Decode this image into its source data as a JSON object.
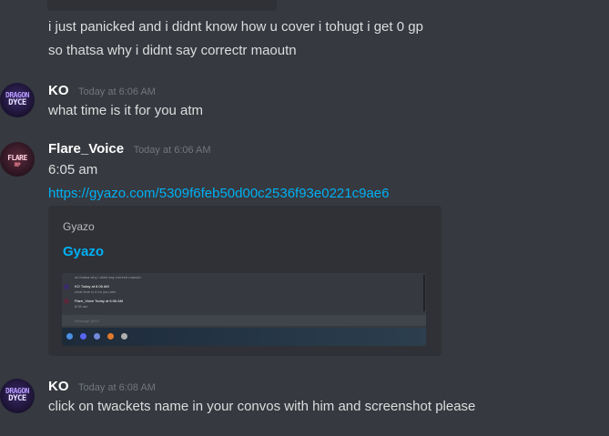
{
  "channel": {
    "messages": [
      {
        "continuation_lines": [
          "i just panicked and i didnt know how u cover i tohugt i get 0 gp",
          "so thatsa why i didnt say correctr maoutn"
        ]
      },
      {
        "author": "KO",
        "timestamp": "Today at 6:06 AM",
        "content": "what time is it for you atm",
        "avatar": {
          "line1": "DRAGON",
          "line2": "DYCE",
          "icon": "dragon-dyce-avatar"
        }
      },
      {
        "author": "Flare_Voice",
        "timestamp": "Today at 6:06 AM",
        "content": "6:05 am",
        "link": "https://gyazo.com/5309f6feb50d00c2536f93e0221c9ae6",
        "avatar": {
          "line1": "FLARE",
          "line2": "RP",
          "icon": "flare-avatar"
        },
        "embed": {
          "provider": "Gyazo",
          "title": "Gyazo",
          "thumbnail": {
            "lines": [
              "so thatsa why i didnt say correctr maoutn",
              "KO  Today at 6:06 AM",
              "what time is it for you atm",
              "Flare_Voice  Today at 6:06 AM",
              "6:05 am",
              "Message @KO"
            ]
          }
        }
      },
      {
        "author": "KO",
        "timestamp": "Today at 6:08 AM",
        "content": "click on twackets name in your convos with him and screenshot please",
        "avatar": {
          "line1": "DRAGON",
          "line2": "DYCE",
          "icon": "dragon-dyce-avatar"
        }
      }
    ]
  },
  "colors": {
    "background": "#36393f",
    "embed_bg": "#2f3136",
    "link": "#00b0f4",
    "username": "#ffffff",
    "timestamp": "#72767d",
    "text": "#dcddde"
  }
}
